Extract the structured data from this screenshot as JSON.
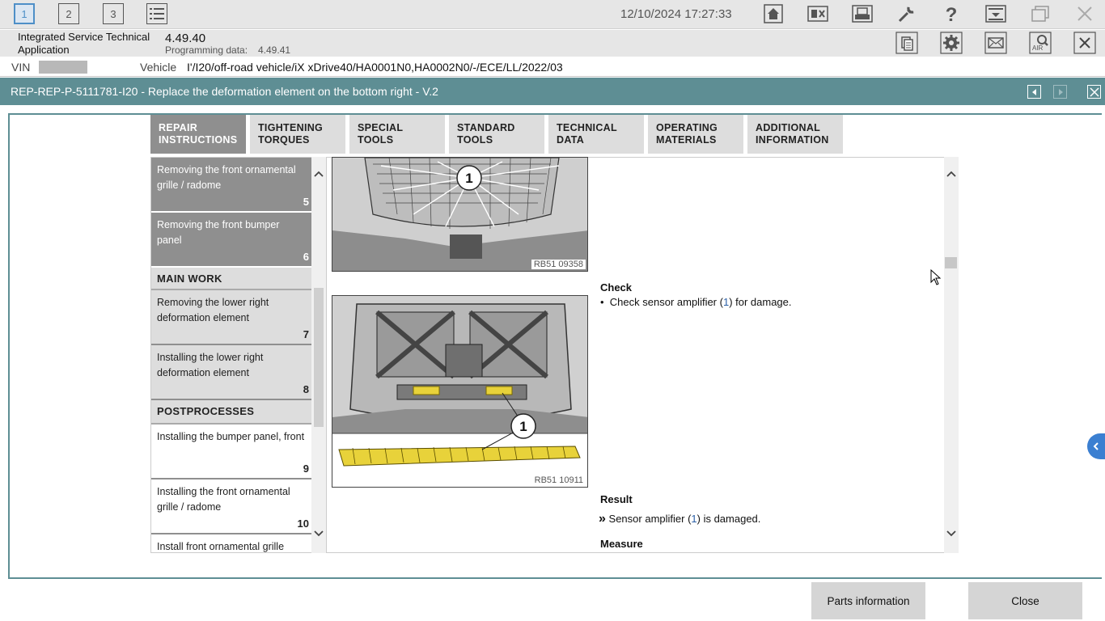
{
  "topbar": {
    "tabs": [
      "1",
      "2",
      "3"
    ],
    "datetime": "12/10/2024 17:27:33",
    "icons": [
      "list-icon",
      "home-icon",
      "keyboard-icon",
      "print-icon",
      "wrench-icon",
      "help-icon",
      "download-icon",
      "window-icon",
      "close-icon"
    ]
  },
  "header": {
    "app_name_line1": "Integrated Service Technical",
    "app_name_line2": "Application",
    "version": "4.49.40",
    "programming_label": "Programming data:",
    "programming_value": "4.49.41",
    "icons": [
      "document-icon",
      "settings-icon",
      "mail-icon",
      "air-search-icon",
      "close-icon"
    ],
    "air_label": "AIR"
  },
  "vehicle_row": {
    "vin_label": "VIN",
    "vehicle_label": "Vehicle",
    "vehicle_value": "I'/I20/off-road vehicle/iX xDrive40/HA0001N0,HA0002N0/-/ECE/LL/2022/03"
  },
  "title": "REP-REP-P-5111781-I20 - Replace the deformation element on the bottom right - V.2",
  "tabs": [
    {
      "line1": "Repair",
      "line2": "instructions",
      "active": true
    },
    {
      "line1": "Tightening",
      "line2": "torques",
      "active": false
    },
    {
      "line1": "Special tools",
      "line2": "",
      "active": false
    },
    {
      "line1": "Standard",
      "line2": "tools",
      "active": false
    },
    {
      "line1": "Technical",
      "line2": "data",
      "active": false
    },
    {
      "line1": "Operating",
      "line2": "materials",
      "active": false
    },
    {
      "line1": "Additional",
      "line2": "information",
      "active": false
    }
  ],
  "toc": {
    "items": [
      {
        "text": "Removing the front ornamental grille / radome",
        "num": "5"
      },
      {
        "text": "Removing the front bumper panel",
        "num": "6"
      },
      {
        "section": "MAIN WORK"
      },
      {
        "text": "Removing the lower right deformation element",
        "num": "7"
      },
      {
        "text": "Installing the lower right deformation element",
        "num": "8"
      },
      {
        "section": "POSTPROCESSES"
      },
      {
        "text": "Installing the bumper panel, front",
        "num": "9"
      },
      {
        "text": "Installing the front ornamental grille / radome",
        "num": "10"
      },
      {
        "text": "Install front ornamental grille",
        "num": ""
      }
    ]
  },
  "content": {
    "figure1_id": "RB51 09358",
    "figure2_id": "RB51 10911",
    "callout": "1",
    "check_heading": "Check",
    "check_bullet": "•",
    "check_prefix": "Check sensor amplifier (",
    "check_ref": "1",
    "check_suffix": ") for damage.",
    "result_heading": "Result",
    "result_marker": "»",
    "result_prefix": "Sensor amplifier (",
    "result_ref": "1",
    "result_suffix": ") is damaged.",
    "measure_heading": "Measure"
  },
  "buttons": {
    "parts_info": "Parts information",
    "close": "Close"
  },
  "colors": {
    "title_bar": "#5e8e94",
    "active_tab": "#8f8f8f",
    "link": "#2a5fa6",
    "highlight_yellow": "#e8d23a"
  }
}
